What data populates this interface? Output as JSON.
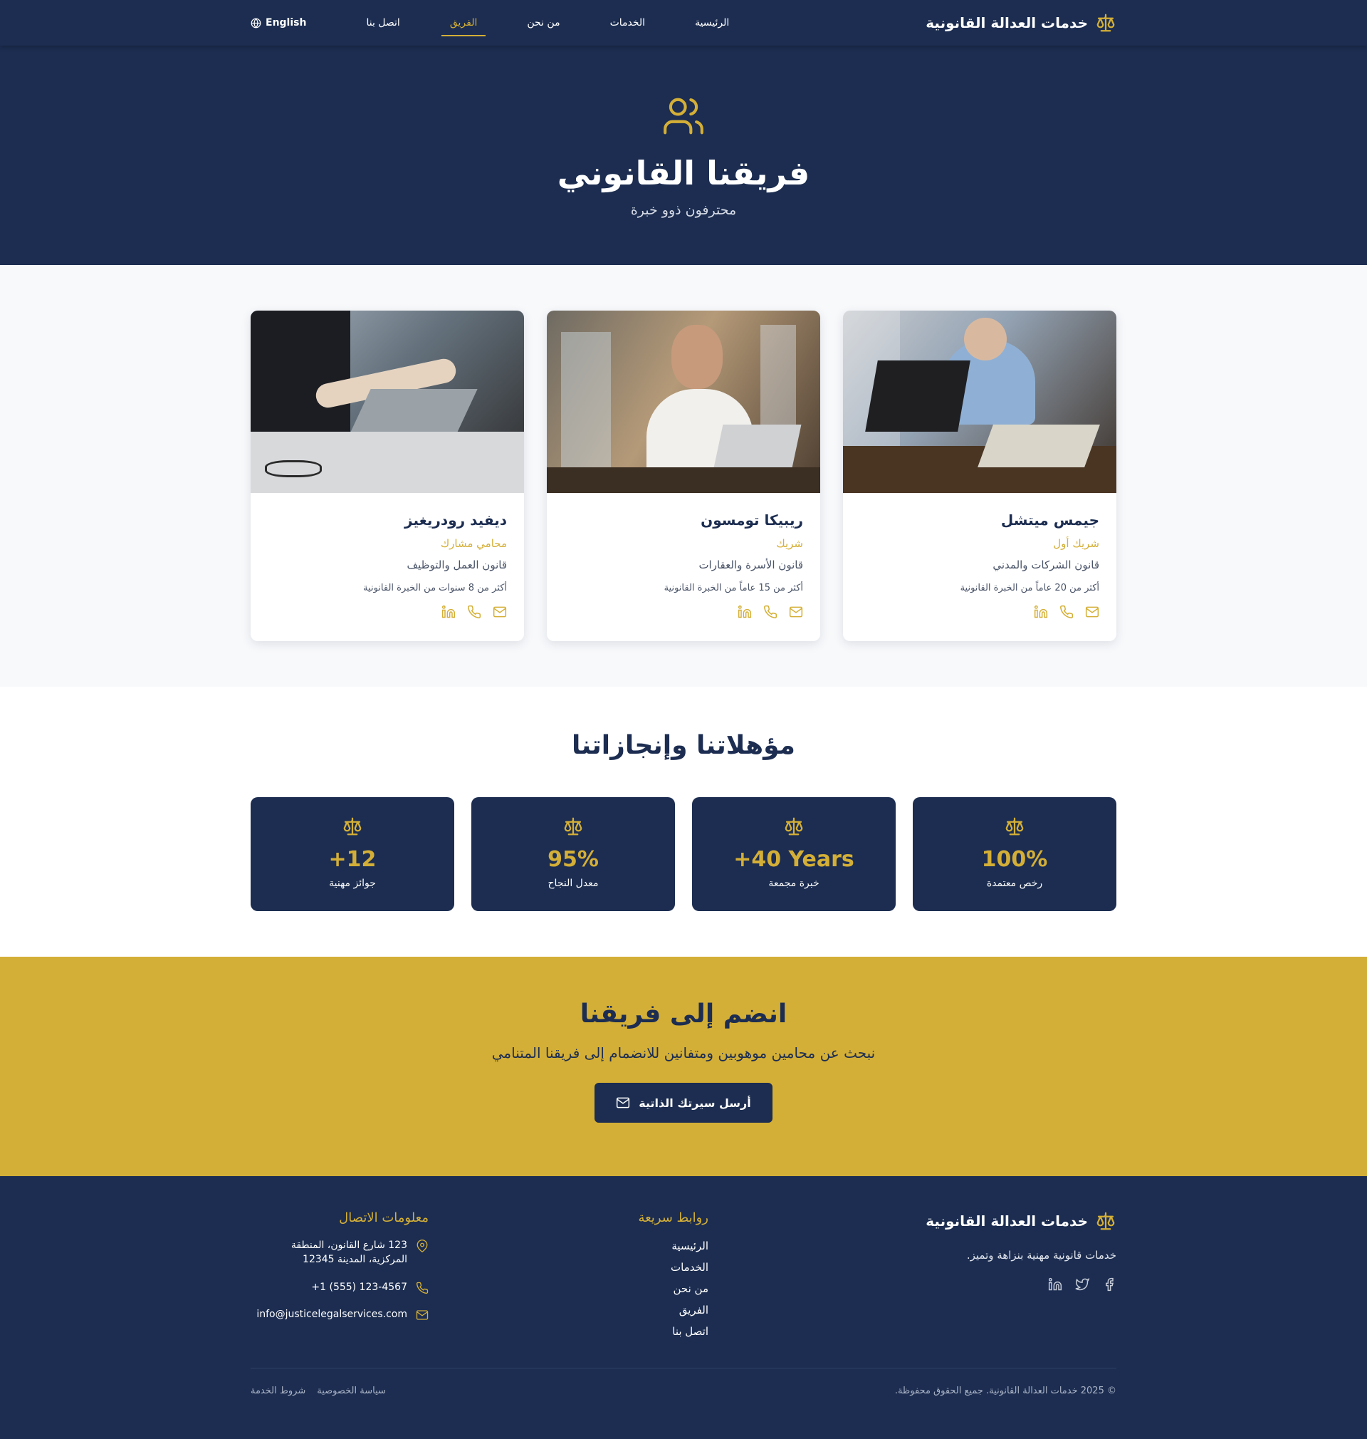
{
  "colors": {
    "navy": "#1c2d51",
    "gold": "#d4af37",
    "light_bg": "#f8f9fb"
  },
  "nav": {
    "brand": "خدمات العدالة القانونية",
    "links": [
      {
        "label": "الرئيسية"
      },
      {
        "label": "الخدمات"
      },
      {
        "label": "من نحن"
      },
      {
        "label": "الفريق"
      },
      {
        "label": "اتصل بنا"
      }
    ],
    "active": "الفريق",
    "language": "English"
  },
  "hero": {
    "icon": "users-icon",
    "title": "فريقنا القانوني",
    "subtitle": "محترفون ذوو خبرة"
  },
  "team": [
    {
      "name": "جيمس ميتشل",
      "role": "شريك أول",
      "specialty": "قانون الشركات والمدني",
      "experience": "أكثر من 20 عاماً من الخبرة القانونية",
      "photo": "laptop-meeting-photo"
    },
    {
      "name": "ريبيكا تومسون",
      "role": "شريك",
      "specialty": "قانون الأسرة والعقارات",
      "experience": "أكثر من 15 عاماً من الخبرة القانونية",
      "photo": "man-on-phone-photo"
    },
    {
      "name": "ديفيد رودريغيز",
      "role": "محامي مشارك",
      "specialty": "قانون العمل والتوظيف",
      "experience": "أكثر من 8 سنوات من الخبرة القانونية",
      "photo": "handshake-photo"
    }
  ],
  "stats": {
    "title": "مؤهلاتنا وإنجازاتنا",
    "items": [
      {
        "value": "100%",
        "label": "رخص معتمدة"
      },
      {
        "value": "+40 Years",
        "label": "خبرة مجمعة"
      },
      {
        "value": "95%",
        "label": "معدل النجاح"
      },
      {
        "value": "+12",
        "label": "جوائز مهنية"
      }
    ]
  },
  "join": {
    "title": "انضم إلى فريقنا",
    "text": "نبحث عن محامين موهوبين ومتفانين للانضمام إلى فريقنا المتنامي",
    "button": "أرسل سيرتك الذاتية"
  },
  "footer": {
    "brand": "خدمات العدالة القانونية",
    "description": "خدمات قانونية مهنية بنزاهة وتميز.",
    "quick_links_title": "روابط سريعة",
    "quick_links": [
      "الرئيسية",
      "الخدمات",
      "من نحن",
      "الفريق",
      "اتصل بنا"
    ],
    "contact_title": "معلومات الاتصال",
    "address": "123 شارع القانون، المنطقة المركزية، المدينة 12345",
    "phone": "+1 (555) 123-4567",
    "email": "info@justicelegalservices.com",
    "copyright": "© 2025 خدمات العدالة القانونية. جميع الحقوق محفوظة.",
    "privacy": "سياسة الخصوصية",
    "terms": "شروط الخدمة"
  }
}
